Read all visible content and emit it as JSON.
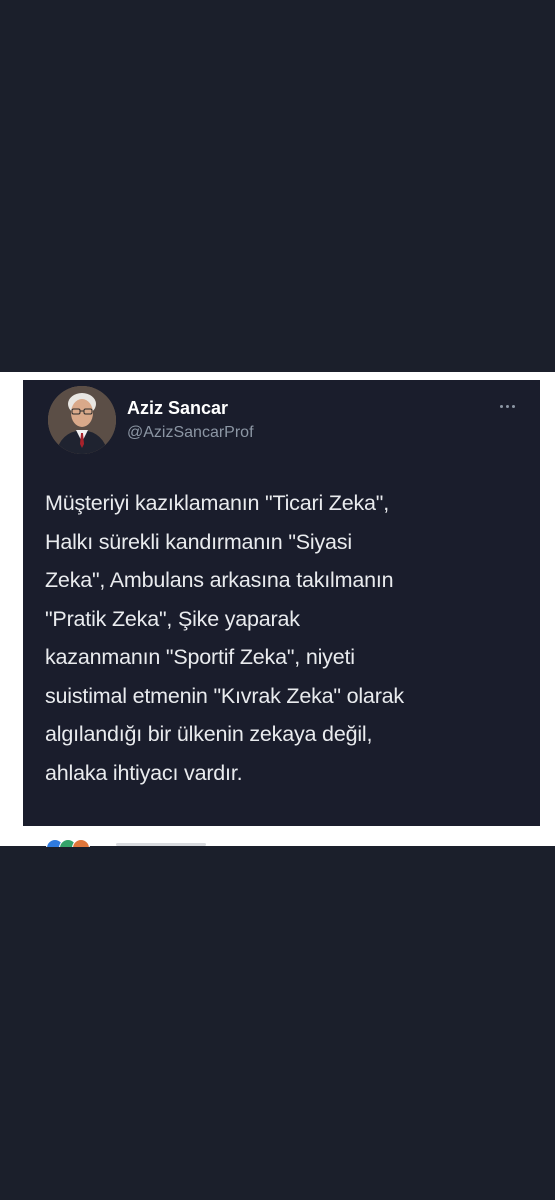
{
  "tweet": {
    "author": {
      "name": "Aziz Sancar",
      "handle": "@AzizSancarProf",
      "avatar_icon": "profile-photo"
    },
    "more_icon": "ellipsis-icon",
    "text": "Müşteriyi kazıklamanın \"Ticari Zeka\",\nHalkı sürekli kandırmanın \"Siyasi\nZeka\", Ambulans arkasına takılmanın\n\"Pratik Zeka\", Şike yaparak\nkazanmanın \"Sportif Zeka\", niyeti\nsuistimal etmenin \"Kıvrak Zeka\" olarak\nalgılandığı bir ülkenin zekaya değil,\nahlaka ihtiyacı vardır."
  },
  "colors": {
    "background": "#1b1f2b",
    "card": "#1a1d2c",
    "text_primary": "#ffffff",
    "text_secondary": "#8c96a4"
  }
}
